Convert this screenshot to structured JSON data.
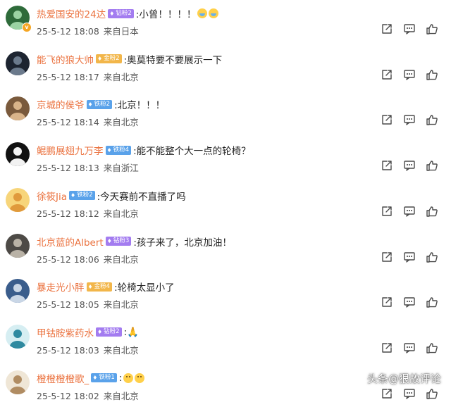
{
  "comments": [
    {
      "user": "热爱国安的24达",
      "fan": {
        "label": "钻粉2",
        "style": "purple"
      },
      "text": ":小曾！！！！",
      "emoji": [
        "cry",
        "cry"
      ],
      "date": "25-5-12 18:08",
      "location": "来自日本",
      "avatar": "green"
    },
    {
      "user": "能飞的狼大帅",
      "fan": {
        "label": "金粉2",
        "style": "gold"
      },
      "text": ":奥莫特要不要展示一下",
      "emoji": [],
      "date": "25-5-12 18:17",
      "location": "来自北京",
      "avatar": "dark"
    },
    {
      "user": "京城的侯爷",
      "fan": {
        "label": "铁粉2",
        "style": "blue"
      },
      "text": ":北京！！！",
      "emoji": [],
      "date": "25-5-12 18:14",
      "location": "来自北京",
      "avatar": "brown"
    },
    {
      "user": "鲲鹏展翅九万李",
      "fan": {
        "label": "铁粉4",
        "style": "blue"
      },
      "text": ":能不能整个大一点的轮椅？",
      "emoji": [],
      "date": "25-5-12 18:13",
      "location": "来自浙江",
      "avatar": "black"
    },
    {
      "user": "徐筱Jia",
      "fan": {
        "label": "铁粉2",
        "style": "blue"
      },
      "text": ":今天赛前不直播了吗",
      "emoji": [],
      "date": "25-5-12 18:12",
      "location": "来自北京",
      "avatar": "yellow"
    },
    {
      "user": "北京蓝的Albert",
      "fan": {
        "label": "钻粉3",
        "style": "purple"
      },
      "text": ":孩子来了，北京加油！",
      "emoji": [],
      "date": "25-5-12 18:06",
      "location": "来自北京",
      "avatar": "gray"
    },
    {
      "user": "暴走光小胖",
      "fan": {
        "label": "金粉4",
        "style": "gold"
      },
      "text": ":轮椅太显小了",
      "emoji": [],
      "date": "25-5-12 18:05",
      "location": "来自北京",
      "avatar": "blue"
    },
    {
      "user": "甲钴胺紫药水",
      "fan": {
        "label": "钻粉2",
        "style": "purple"
      },
      "text": ":🙏",
      "emoji": [],
      "date": "25-5-12 18:03",
      "location": "来自北京",
      "avatar": "teal"
    },
    {
      "user": "橙橙橙橙歌_",
      "fan": {
        "label": "铁粉1",
        "style": "blue"
      },
      "text": ":",
      "emoji": [
        "small",
        "small"
      ],
      "date": "25-5-12 18:02",
      "location": "来自北京",
      "avatar": "cream"
    }
  ],
  "icons": {
    "share": "share-icon",
    "comment": "comment-icon",
    "like": "thumbs-up-icon"
  },
  "watermark": {
    "platform": "头条",
    "handle": "@狠故评论"
  }
}
